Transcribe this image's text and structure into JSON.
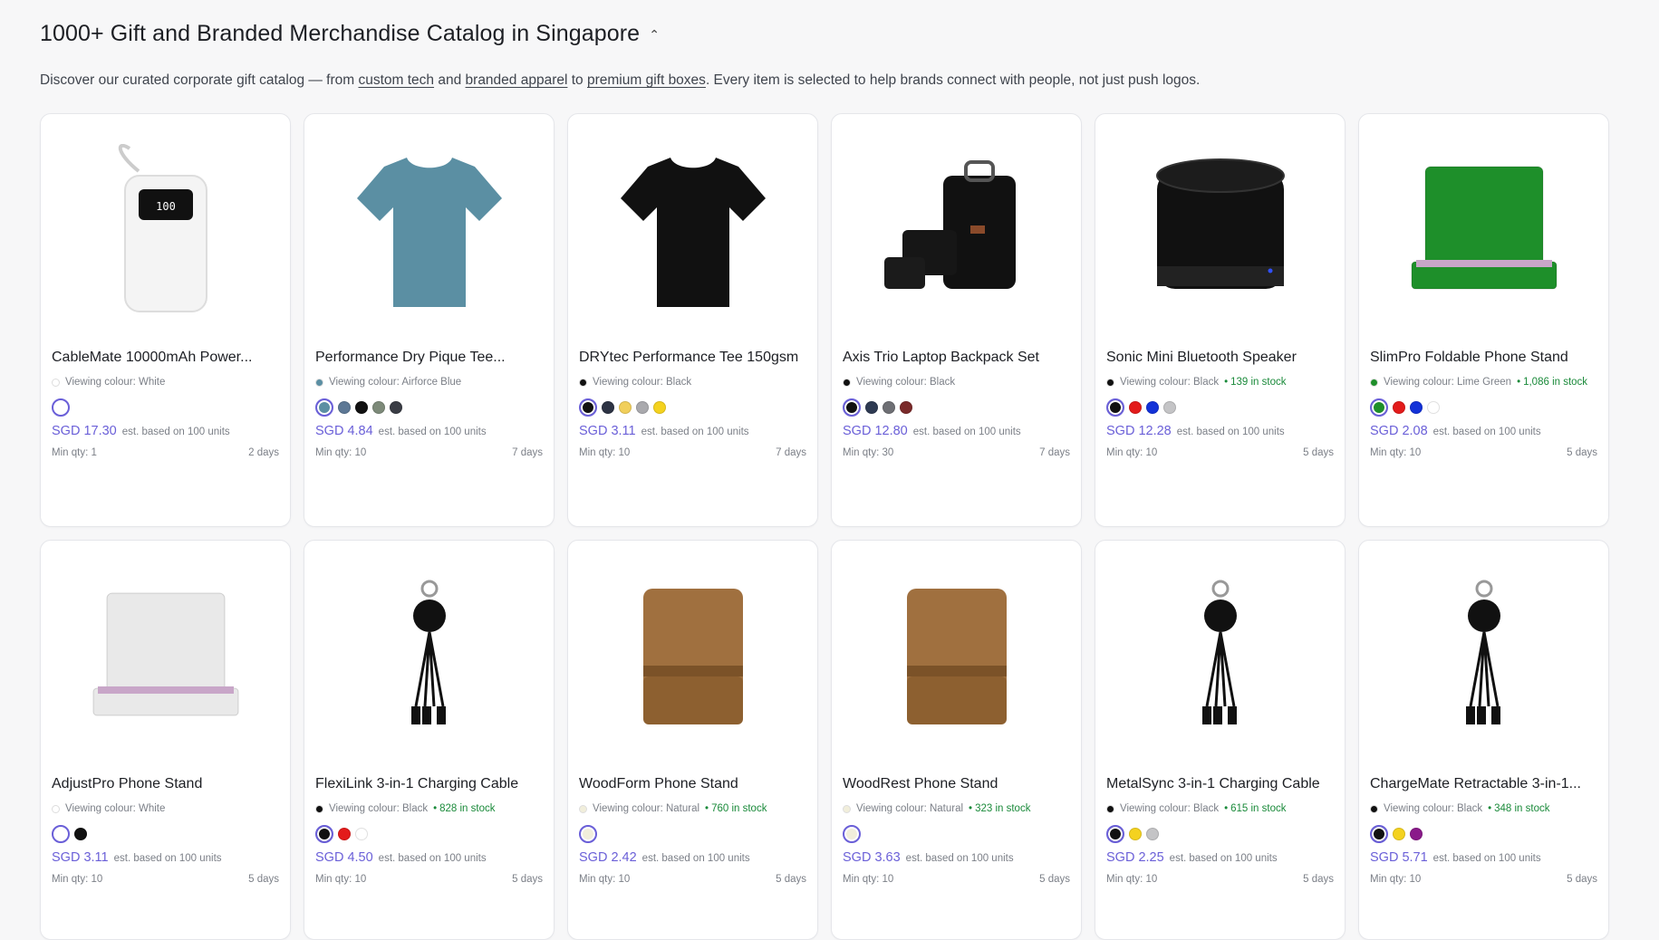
{
  "header": {
    "title": "1000+ Gift and Branded Merchandise Catalog in Singapore",
    "desc_1": "Discover our curated corporate gift catalog — from ",
    "link_tech": "custom tech",
    "desc_2": " and ",
    "link_apparel": "branded apparel",
    "desc_3": " to ",
    "link_boxes": "premium gift boxes",
    "desc_4": ". Every item is selected to help brands connect with people, not just push logos."
  },
  "products": [
    {
      "name": "CableMate 10000mAh Power...",
      "colour_label": "Viewing colour: White",
      "colour": "#ffffff",
      "stock": "",
      "swatches": [
        "#ffffff"
      ],
      "price": "SGD 17.30",
      "est": "est. based on 100 units",
      "min_qty": "Min qty: 1",
      "days": "2 days",
      "icon": "power-bank-icon"
    },
    {
      "name": "Performance Dry Pique Tee...",
      "colour_label": "Viewing colour: Airforce Blue",
      "colour": "#5b8fa3",
      "stock": "",
      "swatches": [
        "#5b8fa3",
        "#5d7895",
        "#111111",
        "#7d8a79",
        "#3a3d45"
      ],
      "price": "SGD 4.84",
      "est": "est. based on 100 units",
      "min_qty": "Min qty: 10",
      "days": "7 days",
      "icon": "tshirt-icon"
    },
    {
      "name": "DRYtec Performance Tee 150gsm",
      "colour_label": "Viewing colour: Black",
      "colour": "#111111",
      "stock": "",
      "swatches": [
        "#111111",
        "#2d3344",
        "#f1cf5b",
        "#a9a9ad",
        "#f4d21f"
      ],
      "price": "SGD 3.11",
      "est": "est. based on 100 units",
      "min_qty": "Min qty: 10",
      "days": "7 days",
      "icon": "tshirt-icon"
    },
    {
      "name": "Axis Trio Laptop Backpack Set",
      "colour_label": "Viewing colour: Black",
      "colour": "#111111",
      "stock": "",
      "swatches": [
        "#111111",
        "#2e3a52",
        "#6e6f74",
        "#7a2a2a"
      ],
      "price": "SGD 12.80",
      "est": "est. based on 100 units",
      "min_qty": "Min qty: 30",
      "days": "7 days",
      "icon": "backpack-icon"
    },
    {
      "name": "Sonic Mini Bluetooth Speaker",
      "colour_label": "Viewing colour: Black",
      "colour": "#111111",
      "stock": "139 in stock",
      "swatches": [
        "#111111",
        "#e31b1b",
        "#1332d8",
        "#c4c4c6"
      ],
      "price": "SGD 12.28",
      "est": "est. based on 100 units",
      "min_qty": "Min qty: 10",
      "days": "5 days",
      "icon": "speaker-icon"
    },
    {
      "name": "SlimPro Foldable Phone Stand",
      "colour_label": "Viewing colour: Lime Green",
      "colour": "#1e8f2a",
      "stock": "1,086 in stock",
      "swatches": [
        "#1e8f2a",
        "#e31b1b",
        "#1332d8",
        "#ffffff"
      ],
      "price": "SGD 2.08",
      "est": "est. based on 100 units",
      "min_qty": "Min qty: 10",
      "days": "5 days",
      "icon": "phone-stand-icon"
    },
    {
      "name": "AdjustPro Phone Stand",
      "colour_label": "Viewing colour: White",
      "colour": "#ffffff",
      "stock": "",
      "swatches": [
        "#ffffff",
        "#111111"
      ],
      "price": "SGD 3.11",
      "est": "est. based on 100 units",
      "min_qty": "Min qty: 10",
      "days": "5 days",
      "icon": "phone-stand-icon"
    },
    {
      "name": "FlexiLink 3-in-1 Charging Cable",
      "colour_label": "Viewing colour: Black",
      "colour": "#111111",
      "stock": "828 in stock",
      "swatches": [
        "#111111",
        "#e31b1b",
        "#ffffff"
      ],
      "price": "SGD 4.50",
      "est": "est. based on 100 units",
      "min_qty": "Min qty: 10",
      "days": "5 days",
      "icon": "cable-icon"
    },
    {
      "name": "WoodForm Phone Stand",
      "colour_label": "Viewing colour: Natural",
      "colour": "#f1eedb",
      "stock": "760 in stock",
      "swatches": [
        "#f1eedb"
      ],
      "price": "SGD 2.42",
      "est": "est. based on 100 units",
      "min_qty": "Min qty: 10",
      "days": "5 days",
      "icon": "wood-stand-icon"
    },
    {
      "name": "WoodRest Phone Stand",
      "colour_label": "Viewing colour: Natural",
      "colour": "#f1eedb",
      "stock": "323 in stock",
      "swatches": [
        "#f1eedb"
      ],
      "price": "SGD 3.63",
      "est": "est. based on 100 units",
      "min_qty": "Min qty: 10",
      "days": "5 days",
      "icon": "wood-stand-icon"
    },
    {
      "name": "MetalSync 3-in-1 Charging Cable",
      "colour_label": "Viewing colour: Black",
      "colour": "#111111",
      "stock": "615 in stock",
      "swatches": [
        "#111111",
        "#f4d21f",
        "#c4c4c6"
      ],
      "price": "SGD 2.25",
      "est": "est. based on 100 units",
      "min_qty": "Min qty: 10",
      "days": "5 days",
      "icon": "cable-icon"
    },
    {
      "name": "ChargeMate Retractable 3-in-1...",
      "colour_label": "Viewing colour: Black",
      "colour": "#111111",
      "stock": "348 in stock",
      "swatches": [
        "#111111",
        "#f4d21f",
        "#8a1a8a"
      ],
      "price": "SGD 5.71",
      "est": "est. based on 100 units",
      "min_qty": "Min qty: 10",
      "days": "5 days",
      "icon": "cable-icon"
    }
  ]
}
